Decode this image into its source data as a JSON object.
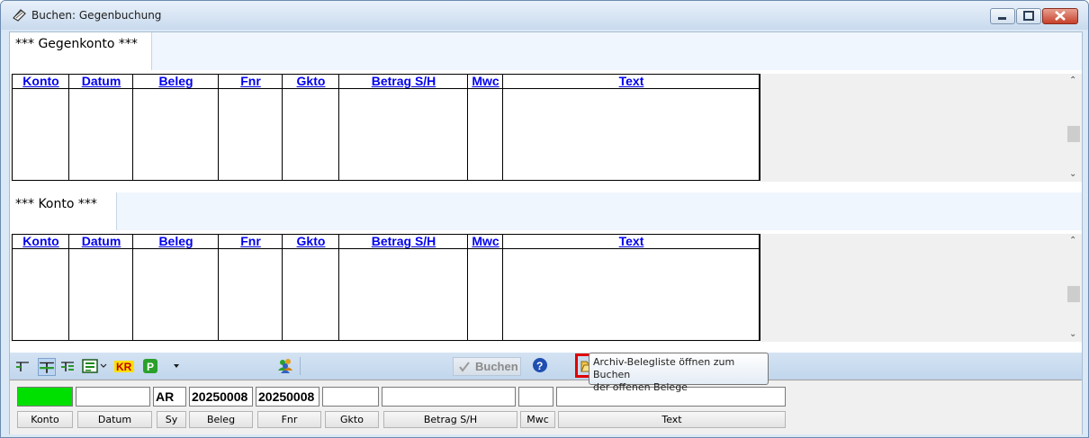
{
  "window": {
    "title": "Buchen: Gegenbuchung"
  },
  "sections": {
    "gegenkonto_label": "*** Gegenkonto ***",
    "konto_label": "*** Konto ***"
  },
  "columns": [
    "Konto",
    "Datum",
    "Beleg",
    "Fnr",
    "Gkto",
    "Betrag S/H",
    "Mwc",
    "Text"
  ],
  "toolbar": {
    "buchen_label": "Buchen",
    "archive_tooltip_line1": "Archiv-Belegliste öffnen zum Buchen",
    "archive_tooltip_line2": "der offenen Belege"
  },
  "form": {
    "fields": {
      "konto": "",
      "datum": "",
      "sy": "AR",
      "beleg": "20250008",
      "fnr": "20250008",
      "gkto": "",
      "betrag": "",
      "mwc": "",
      "text": ""
    },
    "labels": {
      "konto": "Konto",
      "datum": "Datum",
      "sy": "Sy",
      "beleg": "Beleg",
      "fnr": "Fnr",
      "gkto": "Gkto",
      "betrag": "Betrag S/H",
      "mwc": "Mwc",
      "text": "Text"
    }
  },
  "colors": {
    "active_field": "#00e000",
    "header_link": "#0000ee",
    "highlight_border": "#e00000"
  }
}
